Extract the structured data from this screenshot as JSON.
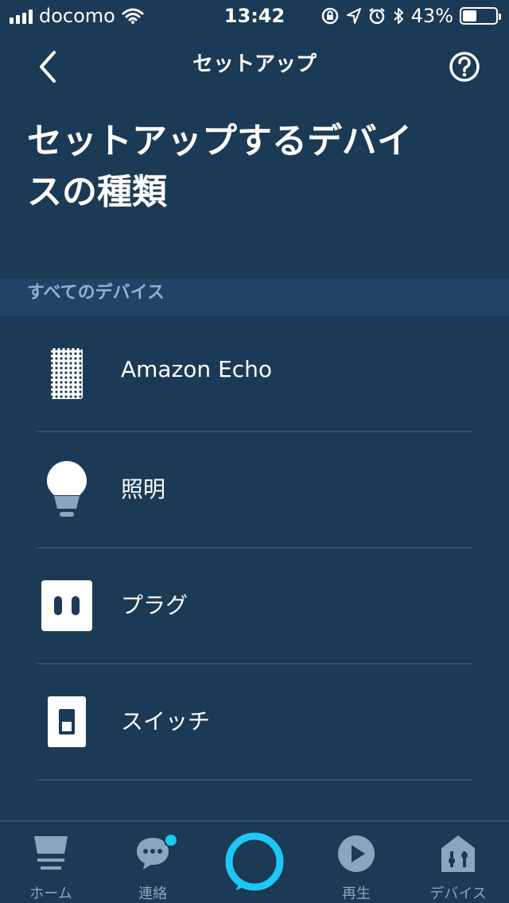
{
  "status_bar": {
    "carrier": "docomo",
    "time": "13:42",
    "battery_percent": "43%",
    "battery_level": 0.43
  },
  "nav": {
    "title": "セットアップ"
  },
  "page": {
    "title": "セットアップするデバイスの種類"
  },
  "section": {
    "header": "すべてのデバイス"
  },
  "devices": [
    {
      "label": "Amazon Echo",
      "icon": "echo-speaker-icon"
    },
    {
      "label": "照明",
      "icon": "light-bulb-icon"
    },
    {
      "label": "プラグ",
      "icon": "plug-icon"
    },
    {
      "label": "スイッチ",
      "icon": "switch-icon"
    }
  ],
  "tabs": [
    {
      "label": "ホーム",
      "icon": "home-icon"
    },
    {
      "label": "連絡",
      "icon": "chat-icon"
    },
    {
      "label": "再生",
      "icon": "play-icon"
    },
    {
      "label": "デバイス",
      "icon": "devices-icon"
    }
  ],
  "colors": {
    "background": "#1b3a55",
    "section_header_bg": "#1f4466",
    "accent": "#1ec8f6",
    "tab_label": "#8aa6bf"
  }
}
